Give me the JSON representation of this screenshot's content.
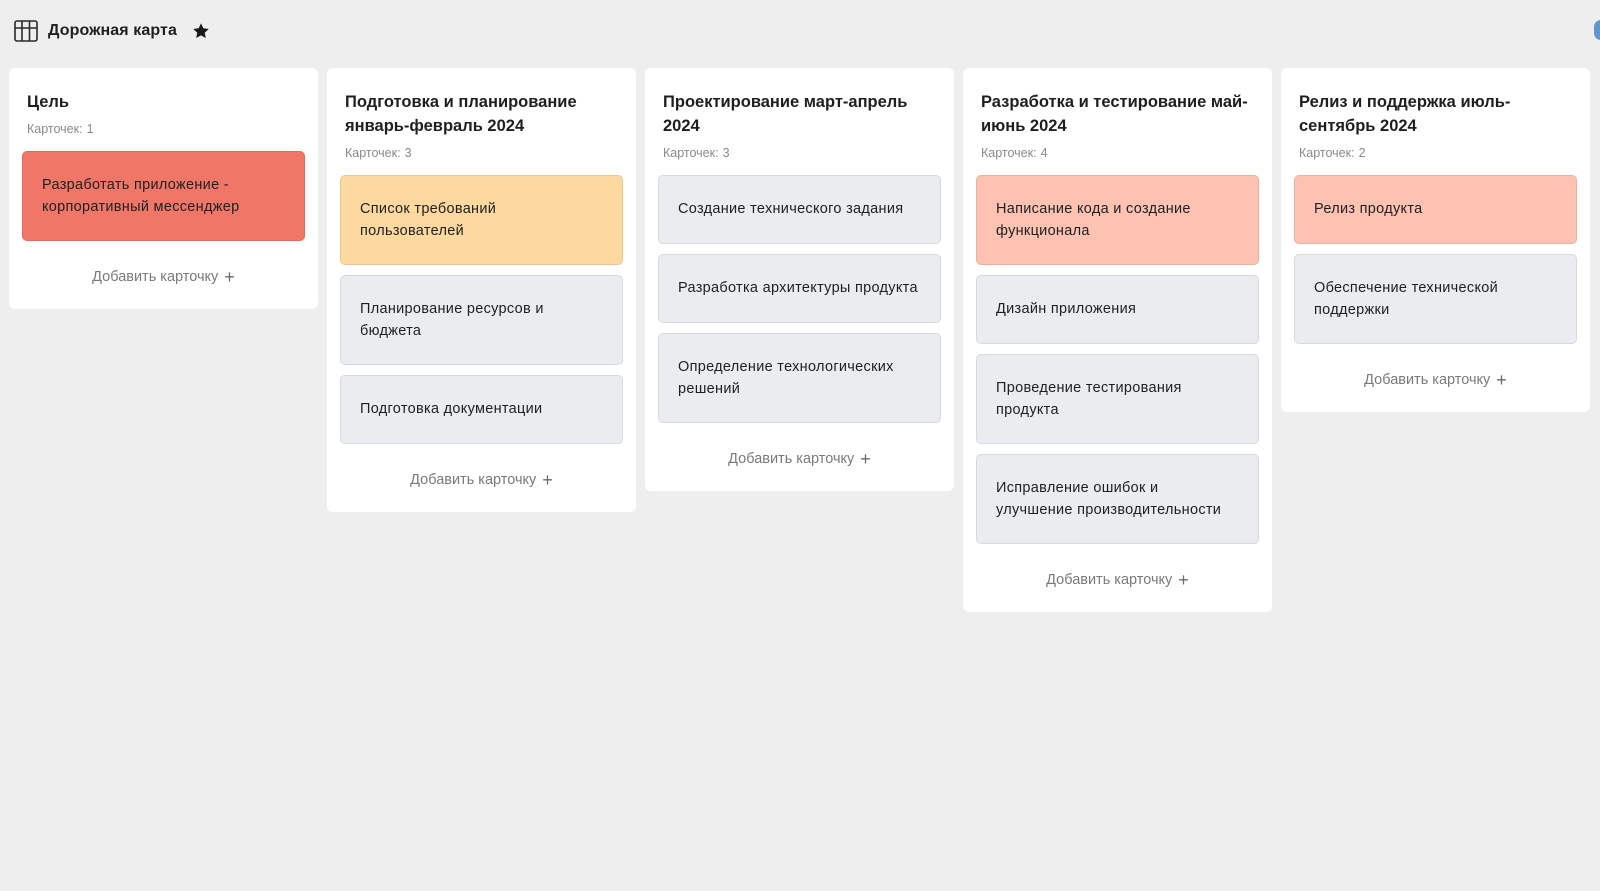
{
  "header": {
    "title": "Дорожная карта",
    "board_icon": "table-layout-icon",
    "star_icon": "star-icon"
  },
  "count_label": "Карточек:",
  "add_card_label": "Добавить карточку",
  "add_icon": "plus-icon",
  "colors": {
    "red": "#f07768",
    "orange": "#fdd89f",
    "salmon": "#fdc2b2",
    "gray": "#ebecef",
    "background": "#eeeeee"
  },
  "columns": [
    {
      "title": "Цель",
      "count": "1",
      "cards": [
        {
          "text": "Разработать приложение - корпоративный мессенджер",
          "color": "#f07768"
        }
      ]
    },
    {
      "title": "Подготовка и планирование январь-февраль 2024",
      "count": "3",
      "cards": [
        {
          "text": "Список требований пользователей",
          "color": "#fdd89f"
        },
        {
          "text": "Планирование ресурсов и бюджета",
          "color": "#ebecef"
        },
        {
          "text": "Подготовка документации",
          "color": "#ebecef"
        }
      ]
    },
    {
      "title": "Проектирование март-апрель 2024",
      "count": "3",
      "cards": [
        {
          "text": "Создание технического задания",
          "color": "#ebecef"
        },
        {
          "text": "Разработка архитектуры продукта",
          "color": "#ebecef"
        },
        {
          "text": "Определение технологических решений",
          "color": "#ebecef"
        }
      ]
    },
    {
      "title": "Разработка и тестирование май-июнь 2024",
      "count": "4",
      "cards": [
        {
          "text": "Написание кода и создание функционала",
          "color": "#fdc2b2"
        },
        {
          "text": "Дизайн приложения",
          "color": "#ebecef"
        },
        {
          "text": "Проведение тестирования продукта",
          "color": "#ebecef"
        },
        {
          "text": "Исправление ошибок и улучшение производительности",
          "color": "#ebecef"
        }
      ]
    },
    {
      "title": "Релиз и поддержка июль-сентябрь 2024",
      "count": "2",
      "cards": [
        {
          "text": "Релиз продукта",
          "color": "#fdc2b2"
        },
        {
          "text": "Обеспечение технической поддержки",
          "color": "#ebecef"
        }
      ]
    }
  ]
}
